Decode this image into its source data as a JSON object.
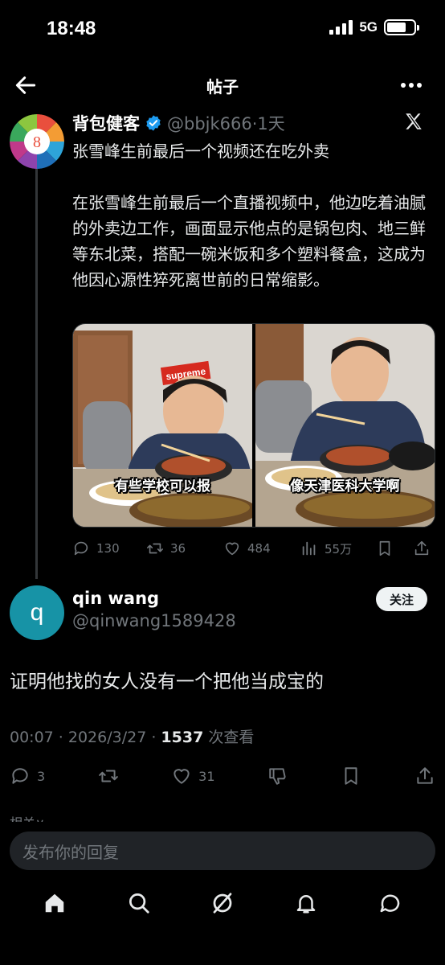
{
  "status_bar": {
    "time": "18:48",
    "network": "5G",
    "battery_level": 0.72
  },
  "nav": {
    "title": "帖子"
  },
  "quoted_post": {
    "author_name": "背包健客",
    "handle_time": "@bbjk666·1天",
    "avatar_number": "8",
    "text": "张雪峰生前最后一个视频还在吃外卖\n\n在张雪峰生前最后一个直播视频中，他边吃着油腻的外卖边工作，画面显示他点的是锅包肉、地三鲜等东北菜，搭配一碗米饭和多个塑料餐盒，这成为他因心源性猝死离世前的日常缩影。",
    "media": [
      {
        "caption": "有些学校可以报",
        "sign": "supreme"
      },
      {
        "caption": "像天津医科大学啊"
      }
    ],
    "actions": {
      "replies": "130",
      "reposts": "36",
      "likes": "484",
      "views": "55万"
    }
  },
  "reply_post": {
    "avatar_letter": "q",
    "author_name": "qin wang",
    "handle": "@qinwang1589428",
    "follow_label": "关注",
    "text": "证明他找的女人没有一个把他当成宝的",
    "meta_prefix": "00:07 · 2026/3/27 · ",
    "views_count": "1537",
    "views_suffix": " 次查看",
    "actions": {
      "replies": "3",
      "likes": "31"
    }
  },
  "related_label": "相关∨",
  "compose": {
    "placeholder": "发布你的回复"
  },
  "colors": {
    "accent": "#1d9bf0",
    "avatar_bg": "#1793a6",
    "muted": "#71767b"
  }
}
